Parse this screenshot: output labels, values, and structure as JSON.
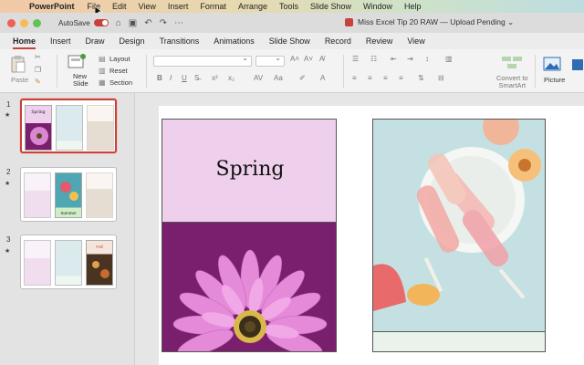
{
  "menubar": {
    "app": "PowerPoint",
    "items": [
      "File",
      "Edit",
      "View",
      "Insert",
      "Format",
      "Arrange",
      "Tools",
      "Slide Show",
      "Window",
      "Help"
    ]
  },
  "titlebar": {
    "autosave_label": "AutoSave",
    "doc_title": "Miss Excel Tip 20 RAW — Upload Pending ⌄"
  },
  "tabs": [
    "Home",
    "Insert",
    "Draw",
    "Design",
    "Transitions",
    "Animations",
    "Slide Show",
    "Record",
    "Review",
    "View"
  ],
  "ribbon": {
    "paste": "Paste",
    "new_slide": "New\nSlide",
    "layout": "Layout",
    "reset": "Reset",
    "section": "Section",
    "convert": "Convert to\nSmartArt",
    "picture": "Picture"
  },
  "slides": [
    {
      "number": "1",
      "star": "★",
      "labels": [
        "Spring",
        "",
        ""
      ]
    },
    {
      "number": "2",
      "star": "★",
      "labels": [
        "",
        "Summer",
        ""
      ]
    },
    {
      "number": "3",
      "star": "★",
      "labels": [
        "",
        "",
        "Fall"
      ]
    }
  ],
  "canvas": {
    "spring_title": "Spring"
  },
  "colors": {
    "accent": "#c8413a",
    "spring_light": "#efd0ec",
    "spring_dark": "#7a1f6e"
  }
}
